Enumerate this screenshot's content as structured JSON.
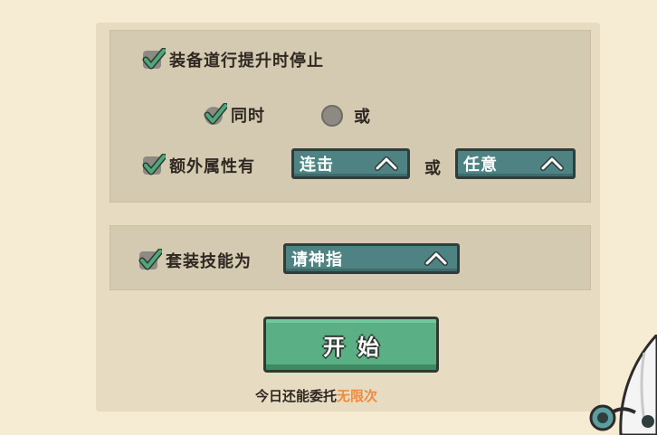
{
  "colors": {
    "accent_green": "#5ab084",
    "dropdown_teal": "#4f8383",
    "check_green": "#4fa87a",
    "unlimited_orange": "#f08a3e"
  },
  "options": {
    "upgrade_stop": {
      "label": "装备道行提升时停止",
      "checked": true
    },
    "mode_and": {
      "label": "同时",
      "checked": true
    },
    "mode_or": {
      "label": "或",
      "checked": false
    },
    "extra_attr": {
      "label": "额外属性有",
      "checked": true,
      "dropdown1": "连击",
      "or_label": "或",
      "dropdown2": "任意"
    },
    "set_skill": {
      "label": "套装技能为",
      "checked": true,
      "dropdown": "请神指"
    }
  },
  "start_button": {
    "label": "开始"
  },
  "remaining": {
    "prefix": "今日还能委托",
    "value": "无限次"
  },
  "icons": [
    "checkmark-icon",
    "radio-empty-icon",
    "chevron-up-icon"
  ]
}
